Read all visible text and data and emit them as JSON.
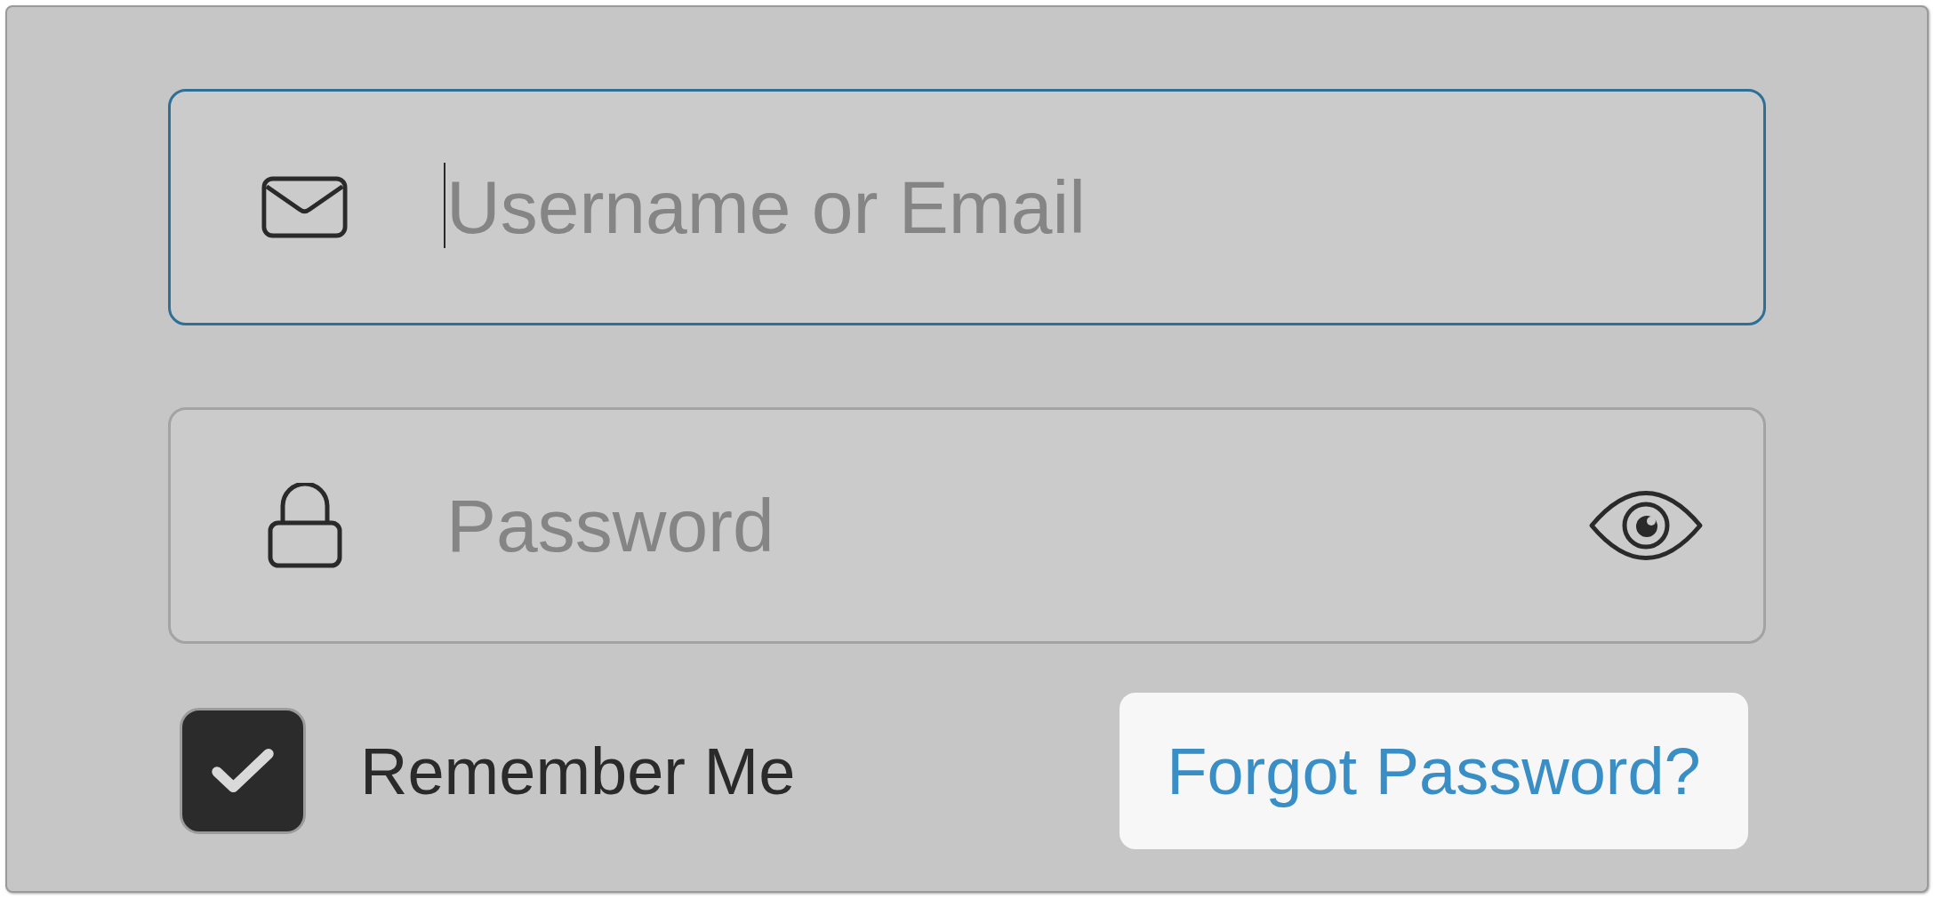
{
  "login_form": {
    "fields": [
      {
        "kind": "username",
        "placeholder": "Username or Email",
        "focused": true
      },
      {
        "kind": "password",
        "placeholder": "Password",
        "focused": false
      }
    ],
    "remember_me": {
      "label": "Remember Me",
      "checked": true
    },
    "forgot_password": {
      "label": "Forgot Password?"
    }
  }
}
